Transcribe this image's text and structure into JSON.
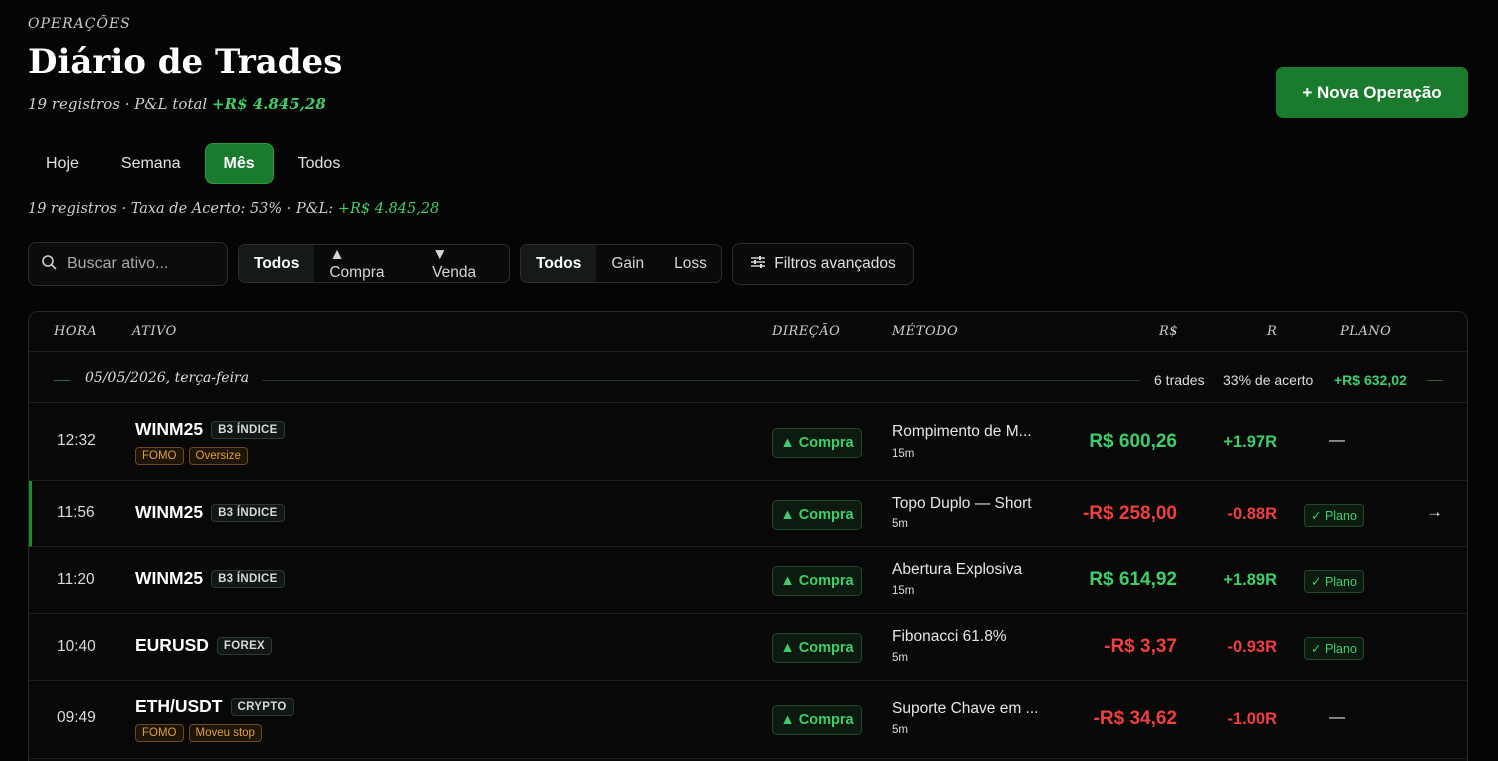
{
  "header": {
    "eyebrow": "OPERAÇÕES",
    "title": "Diário de Trades",
    "count_text": "19 registros · P&L total ",
    "total_pnl": "+R$ 4.845,28",
    "new_button": "+ Nova Operação"
  },
  "tabs": [
    "Hoje",
    "Semana",
    "Mês",
    "Todos"
  ],
  "active_tab": "Mês",
  "summary": {
    "text": "19 registros · Taxa de Acerto: 53% · P&L: ",
    "pnl": "+R$ 4.845,28"
  },
  "filters": {
    "search_placeholder": "Buscar ativo...",
    "direction": [
      "Todos",
      "▲ Compra",
      "▼ Venda"
    ],
    "result": [
      "Todos",
      "Gain",
      "Loss"
    ],
    "advanced": "Filtros avançados"
  },
  "table": {
    "headers": {
      "hora": "HORA",
      "ativo": "ATIVO",
      "direcao": "DIREÇÃO",
      "metodo": "MÉTODO",
      "rs": "R$",
      "r": "R",
      "plano": "PLANO"
    },
    "group": {
      "date": "05/05/2026, terça-feira",
      "trades": "6 trades",
      "accuracy": "33% de acerto",
      "pnl": "+R$ 632,02"
    },
    "rows": [
      {
        "time": "12:32",
        "asset": "WINM25",
        "market": "B3 ÍNDICE",
        "tags": [
          "FOMO",
          "Oversize"
        ],
        "direction": "Compra",
        "method": "Rompimento de M...",
        "timeframe": "15m",
        "money": "R$ 600,26",
        "r": "+1.97R",
        "plan": "—"
      },
      {
        "time": "11:56",
        "asset": "WINM25",
        "market": "B3 ÍNDICE",
        "tags": [],
        "direction": "Compra",
        "method": "Topo Duplo — Short",
        "timeframe": "5m",
        "money": "-R$ 258,00",
        "r": "-0.88R",
        "plan": "✓ Plano",
        "arrow": "→"
      },
      {
        "time": "11:20",
        "asset": "WINM25",
        "market": "B3 ÍNDICE",
        "tags": [],
        "direction": "Compra",
        "method": "Abertura Explosiva",
        "timeframe": "15m",
        "money": "R$ 614,92",
        "r": "+1.89R",
        "plan": "✓ Plano"
      },
      {
        "time": "10:40",
        "asset": "EURUSD",
        "market": "FOREX",
        "tags": [],
        "direction": "Compra",
        "method": "Fibonacci 61.8%",
        "timeframe": "5m",
        "money": "-R$ 3,37",
        "r": "-0.93R",
        "plan": "✓ Plano"
      },
      {
        "time": "09:49",
        "asset": "ETH/USDT",
        "market": "CRYPTO",
        "tags": [
          "FOMO",
          "Moveu stop"
        ],
        "direction": "Compra",
        "method": "Suporte Chave em ...",
        "timeframe": "5m",
        "money": "-R$ 34,62",
        "r": "-1.00R",
        "plan": "—"
      }
    ]
  },
  "colors": {
    "accent": "#1a7a2e",
    "positive": "#3ecf6a",
    "negative": "#ef3f3f",
    "warning": "#e0a030"
  },
  "icons": [
    "search-icon",
    "sliders-icon",
    "triangle-up-icon",
    "arrow-right-icon"
  ]
}
